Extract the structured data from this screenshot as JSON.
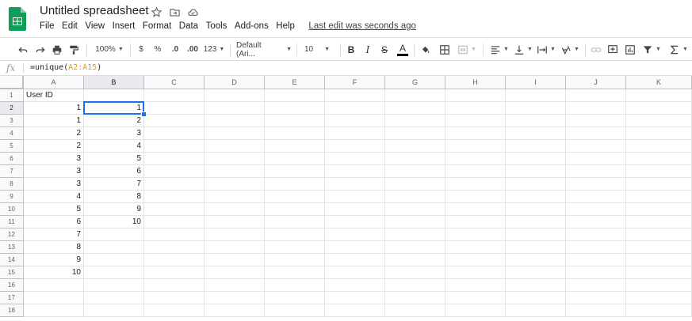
{
  "app": {
    "title": "Untitled spreadsheet",
    "last_edit": "Last edit was seconds ago",
    "menu": [
      "File",
      "Edit",
      "View",
      "Insert",
      "Format",
      "Data",
      "Tools",
      "Add-ons",
      "Help"
    ]
  },
  "toolbar": {
    "zoom": "100%",
    "currency": "$",
    "percent": "%",
    "dec_decrease": ".0",
    "dec_increase": ".00",
    "more_formats": "123",
    "font": "Default (Ari...",
    "font_size": "10",
    "bold": "B",
    "italic": "I",
    "strike": "S",
    "text_color": "A"
  },
  "formula_bar": {
    "fx": "fx",
    "fn_open": "=unique(",
    "range": "A2:A15",
    "fn_close": ")"
  },
  "grid": {
    "columns": [
      "A",
      "B",
      "C",
      "D",
      "E",
      "F",
      "G",
      "H",
      "I",
      "J",
      "K"
    ],
    "selected_column": "B",
    "selected_row": 2,
    "rows": [
      {
        "n": "1",
        "a": "User ID",
        "b": ""
      },
      {
        "n": "2",
        "a": "1",
        "b": "1"
      },
      {
        "n": "3",
        "a": "1",
        "b": "2"
      },
      {
        "n": "4",
        "a": "2",
        "b": "3"
      },
      {
        "n": "5",
        "a": "2",
        "b": "4"
      },
      {
        "n": "6",
        "a": "3",
        "b": "5"
      },
      {
        "n": "7",
        "a": "3",
        "b": "6"
      },
      {
        "n": "8",
        "a": "3",
        "b": "7"
      },
      {
        "n": "9",
        "a": "4",
        "b": "8"
      },
      {
        "n": "10",
        "a": "5",
        "b": "9"
      },
      {
        "n": "11",
        "a": "6",
        "b": "10"
      },
      {
        "n": "12",
        "a": "7",
        "b": ""
      },
      {
        "n": "13",
        "a": "8",
        "b": ""
      },
      {
        "n": "14",
        "a": "9",
        "b": ""
      },
      {
        "n": "15",
        "a": "10",
        "b": ""
      },
      {
        "n": "16",
        "a": "",
        "b": ""
      },
      {
        "n": "17",
        "a": "",
        "b": ""
      },
      {
        "n": "18",
        "a": "",
        "b": ""
      }
    ]
  },
  "colors": {
    "sheets_green": "#0f9d58",
    "selection_blue": "#1a73e8",
    "range_orange": "#f29900"
  }
}
